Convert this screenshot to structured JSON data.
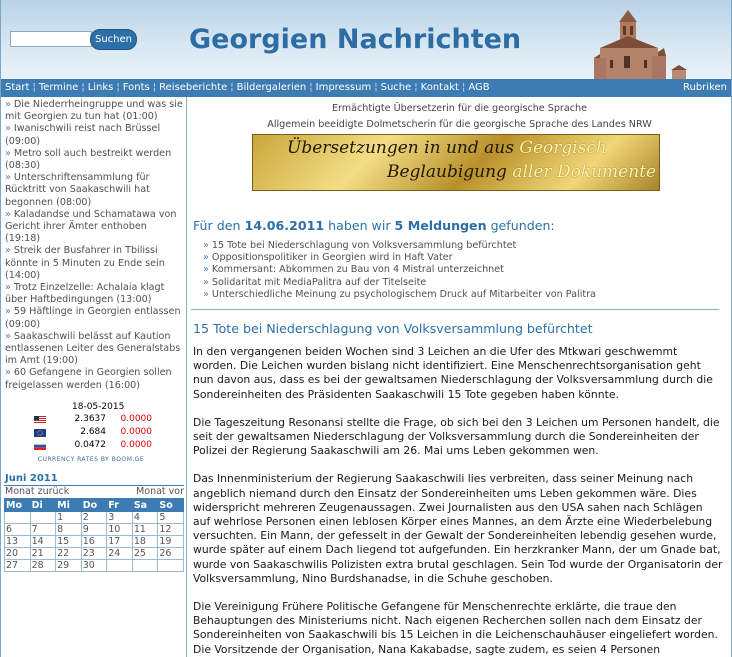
{
  "header": {
    "search_placeholder": "",
    "search_button": "Suchen",
    "site_title": "Georgien Nachrichten"
  },
  "nav": {
    "items": [
      "Start",
      "Termine",
      "Links",
      "Fonts",
      "Reiseberichte",
      "Bildergalerien",
      "Impressum",
      "Suche",
      "Kontakt",
      "AGB"
    ],
    "rubriken": "Rubriken"
  },
  "sidebar": {
    "news": [
      "Die Niederrheingruppe und was sie mit Georgien zu tun hat (01:00)",
      "Iwanischwili reist nach Brüssel (09:00)",
      "Metro soll auch bestreikt werden (08:30)",
      "Unterschriftensammlung für Rücktritt von Saakaschwili hat begonnen (08:00)",
      "Kaladandse und Schamatawa von Gericht ihrer Ämter enthoben (19:18)",
      "Streik der Busfahrer in Tbilissi könnte in 5 Minuten zu Ende sein (14:00)",
      "Trotz Einzelzelle: Achalaia klagt über Haftbedingungen (13:00)",
      "59 Häftlinge in Georgien entlassen (09:00)",
      "Saakaschwili belässt auf Kaution entlassenen Leiter des Generalstabs im Amt (19:00)",
      "60 Gefangene in Georgien sollen freigelassen werden (16:00)"
    ],
    "currency": {
      "date": "18-05-2015",
      "rows": [
        {
          "flag": "us-flag",
          "value": "2.3637",
          "change": "0.0000"
        },
        {
          "flag": "eu-flag",
          "value": "2.684",
          "change": "0.0000"
        },
        {
          "flag": "ru-flag",
          "value": "0.0472",
          "change": "0.0000"
        }
      ],
      "footer": "CURRENCY RATES BY BOOM.GE"
    },
    "calendar": {
      "title": "Juni 2011",
      "prev": "Monat zurück",
      "next": "Monat vor",
      "days": [
        "Mo",
        "Di",
        "Mi",
        "Do",
        "Fr",
        "Sa",
        "So"
      ],
      "weeks": [
        [
          "",
          "",
          "1",
          "2",
          "3",
          "4",
          "5"
        ],
        [
          "6",
          "7",
          "8",
          "9",
          "10",
          "11",
          "12"
        ],
        [
          "13",
          "14",
          "15",
          "16",
          "17",
          "18",
          "19"
        ],
        [
          "20",
          "21",
          "22",
          "23",
          "24",
          "25",
          "26"
        ],
        [
          "27",
          "28",
          "29",
          "30",
          "",
          "",
          ""
        ]
      ]
    }
  },
  "main": {
    "ad_line1": "Ermächtigte Übersetzerin für die georgische Sprache",
    "ad_line2": "Allgemein beeidigte Dolmetscherin für die georgische Sprache des Landes NRW",
    "banner": {
      "l1_pre": "Übersetzungen in und aus ",
      "l1_hl": "Georgisch",
      "l2_pre": "Beglaubigung ",
      "l2_hl": "aller Dokumente"
    },
    "result": {
      "pre": "Für den ",
      "date": "14.06.2011",
      "mid": " haben wir ",
      "count": "5 Meldungen",
      "post": " gefunden:"
    },
    "result_list": [
      "15 Tote bei Niederschlagung von Volksversammlung befürchtet",
      "Oppositionspolitiker in Georgien wird in Haft Vater",
      "Kommersant: Abkommen zu Bau von 4 Mistral unterzeichnet",
      "Solidaritat mit MediaPalitra auf der Titelseite",
      " Unterschiedliche Meinung zu psychologischem Druck auf Mitarbeiter von Palitra"
    ],
    "article_title": "15 Tote bei Niederschlagung von Volksversammlung befürchtet",
    "paragraphs": [
      "In den vergangenen beiden Wochen sind 3 Leichen an die Ufer des Mtkwari geschwemmt worden. Die Leichen wurden bislang nicht identifiziert. Eine Menschenrechtsorganisation geht nun davon aus, dass es bei der gewaltsamen Niederschlagung der Volksversammlung durch die Sondereinheiten des Präsidenten Saakaschwili 15 Tote gegeben haben könnte.",
      "Die Tageszeitung Resonansi stellte die Frage, ob sich bei den 3 Leichen um Personen handelt, die seit der gewaltsamen Niederschlagung der Volksversammlung durch die Sondereinheiten der Polizei der Regierung Saakaschwili am 26. Mai ums Leben gekommen wen.",
      "Das Innenministerium der Regierung Saakaschwili lies verbreiten, dass seiner Meinung nach angeblich niemand durch den Einsatz der Sondereinheiten ums Leben gekommen wäre. Dies widerspricht mehreren Zeugenaussagen. Zwei Journalisten aus den USA sahen nach Schlägen auf wehrlose Personen einen leblosen Körper eines Mannes, an dem Ärzte eine Wiederbelebung versuchten. Ein Mann, der gefesselt in der Gewalt der Sondereinheiten lebendig gesehen wurde, wurde später auf einem Dach liegend tot aufgefunden. Ein herzkranker Mann, der um Gnade bat, wurde von Saakaschwilis Polizisten extra brutal geschlagen. Sein Tod wurde der Organisatorin der Volksversammlung, Nino Burdshanadse, in die Schuhe geschoben.",
      "Die Vereinigung Frühere Politische Gefangene für Menschenrechte erklärte, die traue den Behauptungen des Ministeriums nicht. Nach eigenen Recherchen sollen nach dem Einsatz der Sondereinheiten von Saakaschwili bis 15 Leichen in die Leichenschauhäuser eingeliefert worden. Die Vorsitzende der Organisation, Nana Kakabadse, sagte zudem, es seien 4 Personen"
    ]
  }
}
